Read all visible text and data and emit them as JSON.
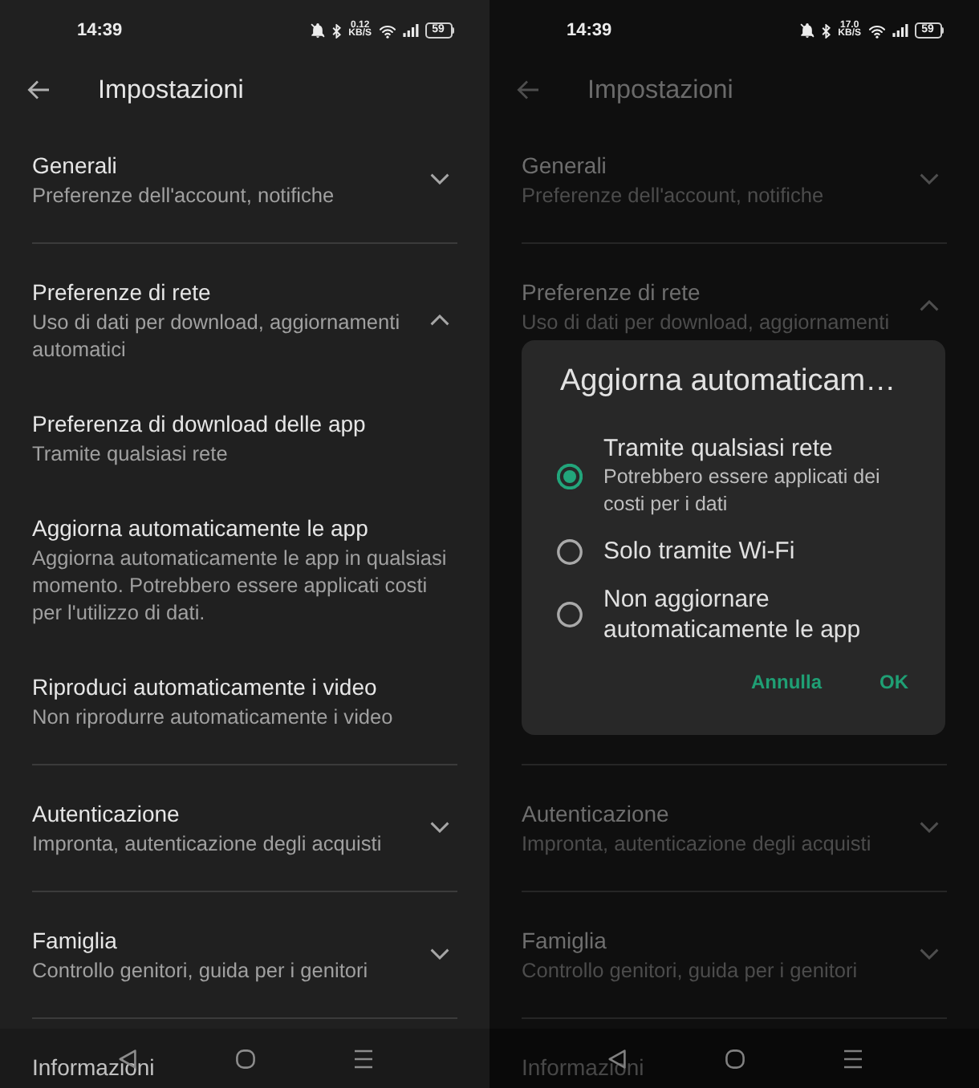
{
  "phones": [
    {
      "dimmed": false,
      "status_bar": {
        "time": "14:39",
        "network_speed": "0.12",
        "network_speed_unit": "KB/S",
        "battery": "59"
      },
      "app_bar": {
        "title": "Impostazioni"
      },
      "sections": [
        {
          "title": "Generali",
          "subtitle": "Preferenze dell'account, notifiche",
          "expanded": false
        },
        {
          "title": "Preferenze di rete",
          "subtitle": "Uso di dati per download, aggiornamenti automatici",
          "expanded": true,
          "children": [
            {
              "title": "Preferenza di download delle app",
              "subtitle": "Tramite qualsiasi rete"
            },
            {
              "title": "Aggiorna automaticamente le app",
              "subtitle": "Aggiorna automaticamente le app in qualsiasi momento. Potrebbero essere applicati costi per l'utilizzo di dati."
            },
            {
              "title": "Riproduci automaticamente i video",
              "subtitle": "Non riprodurre automaticamente i video"
            }
          ]
        },
        {
          "title": "Autenticazione",
          "subtitle": "Impronta, autenticazione degli acquisti",
          "expanded": false
        },
        {
          "title": "Famiglia",
          "subtitle": "Controllo genitori, guida per i genitori",
          "expanded": false
        },
        {
          "title": "Informazioni"
        }
      ]
    },
    {
      "dimmed": true,
      "status_bar": {
        "time": "14:39",
        "network_speed": "17.0",
        "network_speed_unit": "KB/S",
        "battery": "59"
      },
      "app_bar": {
        "title": "Impostazioni"
      },
      "sections": [
        {
          "title": "Generali",
          "subtitle": "Preferenze dell'account, notifiche",
          "expanded": false
        },
        {
          "title": "Preferenze di rete",
          "subtitle": "Uso di dati per download, aggiornamenti",
          "expanded": true
        }
      ],
      "dialog": {
        "title": "Aggiorna automaticam…",
        "options": [
          {
            "label": "Tramite qualsiasi rete",
            "description": "Potrebbero essere applicati dei costi per i dati",
            "selected": true
          },
          {
            "label": "Solo tramite Wi-Fi",
            "selected": false
          },
          {
            "label": "Non aggiornare automaticamente le app",
            "selected": false
          }
        ],
        "buttons": [
          "Annulla",
          "OK"
        ]
      },
      "sections_below": [
        {
          "title": "Autenticazione",
          "subtitle": "Impronta, autenticazione degli acquisti",
          "expanded": false
        },
        {
          "title": "Famiglia",
          "subtitle": "Controllo genitori, guida per i genitori",
          "expanded": false
        },
        {
          "title": "Informazioni"
        }
      ]
    }
  ]
}
